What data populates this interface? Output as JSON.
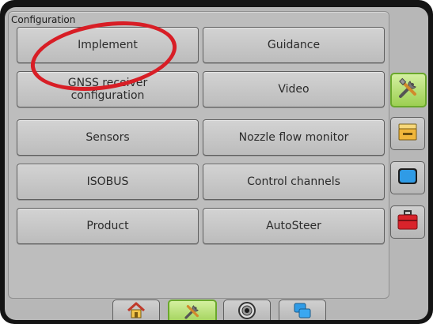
{
  "panel": {
    "title": "Configuration"
  },
  "buttons": [
    {
      "label": "Implement"
    },
    {
      "label": "Guidance"
    },
    {
      "label": "GNSS receiver\nconfiguration"
    },
    {
      "label": "Video"
    },
    {
      "label": "Sensors"
    },
    {
      "label": "Nozzle flow monitor"
    },
    {
      "label": "ISOBUS"
    },
    {
      "label": "Control channels"
    },
    {
      "label": "Product"
    },
    {
      "label": "AutoSteer"
    }
  ],
  "side_tabs": [
    {
      "icon": "tools-icon",
      "active": true
    },
    {
      "icon": "console-icon",
      "active": false
    },
    {
      "icon": "display-icon",
      "active": false
    },
    {
      "icon": "toolbox-icon",
      "active": false
    }
  ],
  "bottom_tabs": [
    {
      "icon": "home-icon",
      "active": false
    },
    {
      "icon": "tools-icon",
      "active": true
    },
    {
      "icon": "guidance-icon",
      "active": false
    },
    {
      "icon": "windows-icon",
      "active": false
    }
  ],
  "colors": {
    "active_tab": "#9ccf52",
    "highlight_ring": "#d81e26"
  }
}
